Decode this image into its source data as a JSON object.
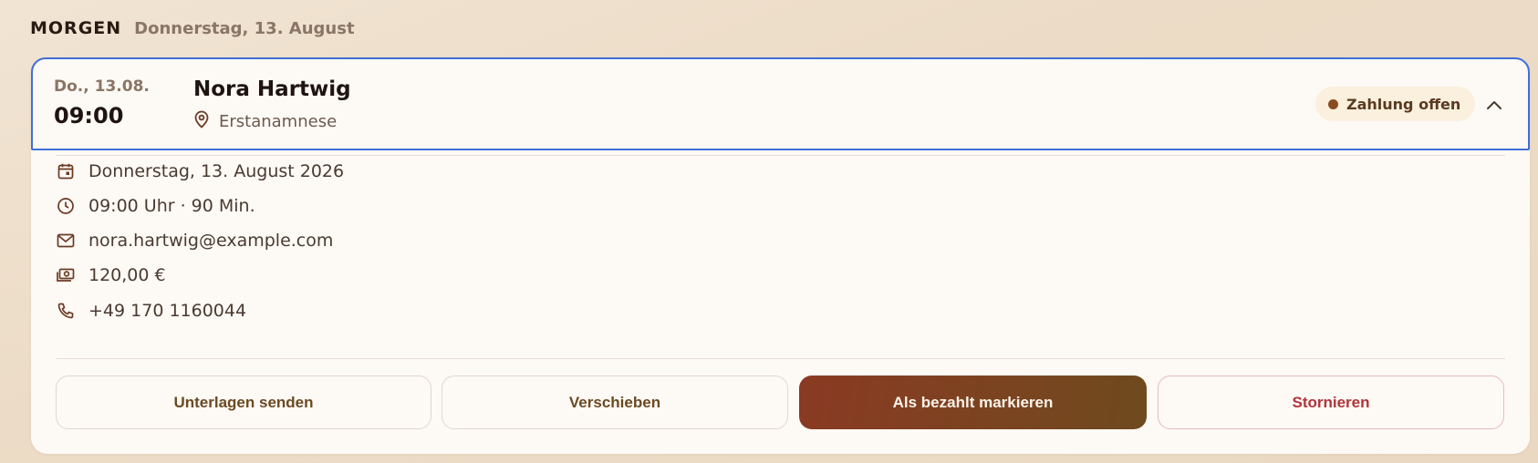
{
  "section": {
    "title": "MORGEN",
    "date": "Donnerstag, 13. August"
  },
  "appointment": {
    "short_date": "Do., 13.08.",
    "time": "09:00",
    "client_name": "Nora Hartwig",
    "location": "Erstanamnese",
    "status_label": "Zahlung offen",
    "status_color": "#8a4a22",
    "details": {
      "date": "Donnerstag, 13. August 2026",
      "time_duration": "09:00 Uhr · 90 Min.",
      "email": "nora.hartwig@example.com",
      "price": "120,00 €",
      "phone": "+49 170 1160044"
    }
  },
  "actions": {
    "send_documents": "Unterlagen senden",
    "reschedule": "Verschieben",
    "mark_paid": "Als bezahlt markieren",
    "cancel": "Stornieren"
  },
  "icons": {
    "location": "map-pin-icon",
    "collapse": "chevron-up-icon",
    "date": "calendar-icon",
    "time": "clock-icon",
    "email": "mail-icon",
    "price": "money-icon",
    "phone": "phone-icon"
  },
  "colors": {
    "accent": "#7a4420",
    "focus_border": "#3f6fd8",
    "danger": "#b0343a"
  }
}
